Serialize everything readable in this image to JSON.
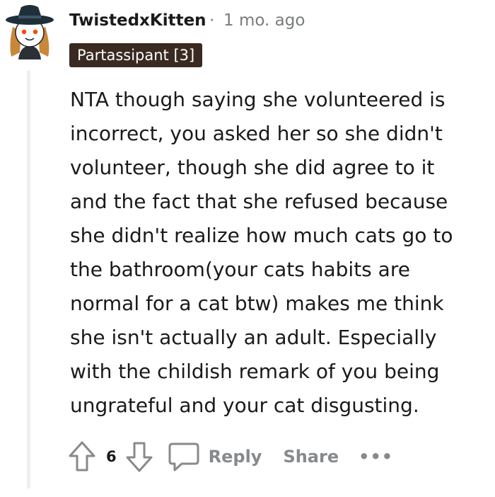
{
  "comment": {
    "username": "TwistedxKitten",
    "separator": "·",
    "timestamp": "1 mo. ago",
    "flair": "Partassipant [3]",
    "body": "NTA though saying she volunteered is\nincorrect, you asked her so she didn't\nvolunteer, though she did agree to it\nand the fact that she refused because\nshe didn't realize how much cats go to\nthe bathroom(your cats habits are\nnormal for a cat btw) makes me think\nshe isn't actually an adult. Especially\nwith the childish remark of you being\nungrateful and your cat disgusting."
  },
  "actions": {
    "vote_count": "6",
    "reply_label": "Reply",
    "share_label": "Share",
    "more_label": "•••"
  },
  "icons": {
    "avatar": "avatar-witch-hat",
    "upvote": "upvote-arrow-icon",
    "downvote": "downvote-arrow-icon",
    "reply": "speech-bubble-icon",
    "more": "ellipsis-icon"
  },
  "colors": {
    "flair_bg": "#3a2a22",
    "muted": "#878a8c",
    "text": "#1a1a1b",
    "thread_line": "#edeff1"
  }
}
